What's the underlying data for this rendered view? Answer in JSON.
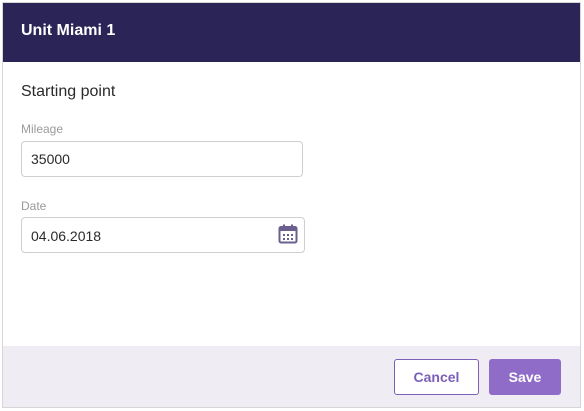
{
  "dialog": {
    "title": "Unit Miami 1",
    "section_title": "Starting point",
    "mileage": {
      "label": "Mileage",
      "value": "35000"
    },
    "date": {
      "label": "Date",
      "value": "04.06.2018",
      "icon": "calendar-icon"
    },
    "buttons": {
      "cancel": "Cancel",
      "save": "Save"
    }
  },
  "colors": {
    "header_bg": "#2b2456",
    "accent": "#8f6cc8",
    "footer_bg": "#efedf3"
  }
}
